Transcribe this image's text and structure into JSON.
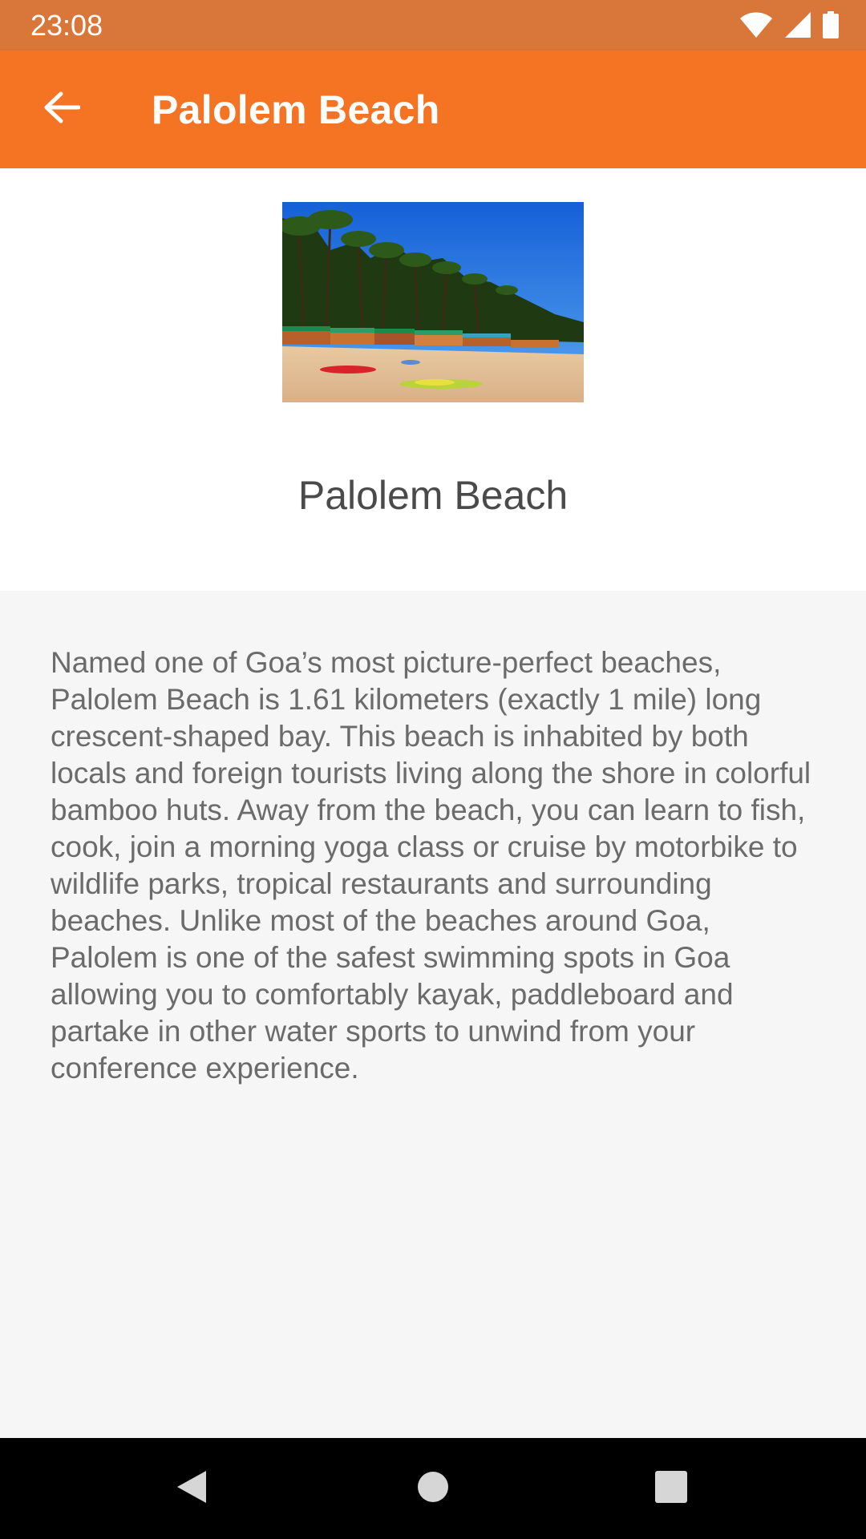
{
  "status_bar": {
    "time": "23:08",
    "icons": [
      "wifi-icon",
      "cellular-signal-icon",
      "battery-icon"
    ]
  },
  "app_bar": {
    "title": "Palolem Beach",
    "back_icon": "arrow-back-icon",
    "background_color": "#f47424"
  },
  "place": {
    "name": "Palolem Beach",
    "image_description": "beach photo"
  },
  "description": "Named one of Goa’s most picture-perfect beaches, Palolem Beach is 1.61 kilometers (exactly 1 mile) long crescent-shaped bay. This beach is inhabited by both locals and foreign tourists living along the shore in colorful bamboo huts. Away from the beach, you can learn to fish, cook, join a morning yoga class or cruise by motorbike to wildlife parks, tropical restaurants and surrounding beaches. Unlike most of the beaches around Goa, Palolem is one of the safest swimming spots in Goa allowing you to comfortably kayak, paddleboard and partake in other water sports to unwind from your conference experience.",
  "nav_bar": {
    "buttons": [
      "nav-back-icon",
      "nav-home-icon",
      "nav-recents-icon"
    ]
  },
  "colors": {
    "status_bar": "#d9763a",
    "app_bar": "#f47424",
    "text_body": "#6b6b6b",
    "content_bg": "#f6f6f6"
  }
}
